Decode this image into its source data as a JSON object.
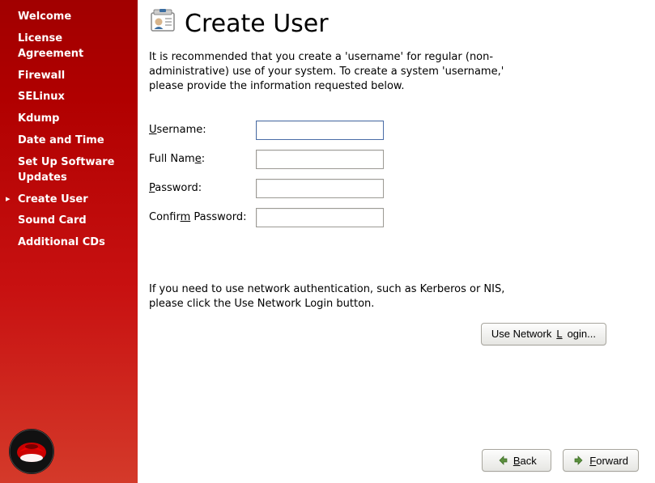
{
  "sidebar": {
    "items": [
      {
        "label": "Welcome",
        "active": false
      },
      {
        "label": "License Agreement",
        "active": false
      },
      {
        "label": "Firewall",
        "active": false
      },
      {
        "label": "SELinux",
        "active": false
      },
      {
        "label": "Kdump",
        "active": false
      },
      {
        "label": "Date and Time",
        "active": false
      },
      {
        "label": "Set Up Software Updates",
        "active": false
      },
      {
        "label": "Create User",
        "active": true
      },
      {
        "label": "Sound Card",
        "active": false
      },
      {
        "label": "Additional CDs",
        "active": false
      }
    ]
  },
  "header": {
    "title": "Create User"
  },
  "intro": "It is recommended that you create a 'username' for regular (non-administrative) use of your system. To create a system 'username,' please provide the information requested below.",
  "form": {
    "username": {
      "label_pre": "U",
      "label_post": "sername:",
      "value": ""
    },
    "fullname": {
      "label_pre": "Full Nam",
      "label_u": "e",
      "label_post": ":",
      "value": ""
    },
    "password": {
      "label_pre": "P",
      "label_post": "assword:",
      "value": ""
    },
    "confirm": {
      "label_pre": "Confir",
      "label_u": "m",
      "label_post": " Password:",
      "value": ""
    }
  },
  "network": {
    "text": "If you need to use network authentication, such as Kerberos or NIS, please click the Use Network Login button.",
    "button_pre": "Use Network ",
    "button_u": "L",
    "button_post": "ogin..."
  },
  "footer": {
    "back_u": "B",
    "back_post": "ack",
    "forward_u": "F",
    "forward_post": "orward"
  }
}
